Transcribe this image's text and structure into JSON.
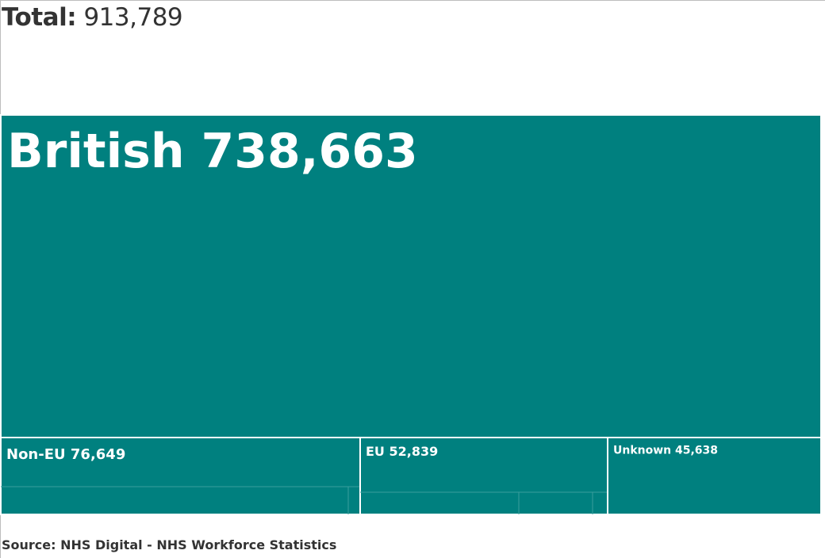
{
  "total": {
    "label": "Total:",
    "value": "913,789"
  },
  "colors": {
    "fill": "#00807F",
    "border": "#ffffff",
    "subdivider": "#3a9e9c",
    "text": "#333333",
    "label_text": "#ffffff"
  },
  "chart_data": {
    "type": "treemap",
    "total": 913789,
    "nodes": [
      {
        "label": "British",
        "value_text": "738,663",
        "value": 738663
      },
      {
        "label": "Non-EU",
        "value_text": "76,649",
        "value": 76649
      },
      {
        "label": "EU",
        "value_text": "52,839",
        "value": 52839
      },
      {
        "label": "Unknown",
        "value_text": "45,638",
        "value": 45638
      }
    ]
  },
  "source": "Source: NHS Digital - NHS Workforce Statistics"
}
